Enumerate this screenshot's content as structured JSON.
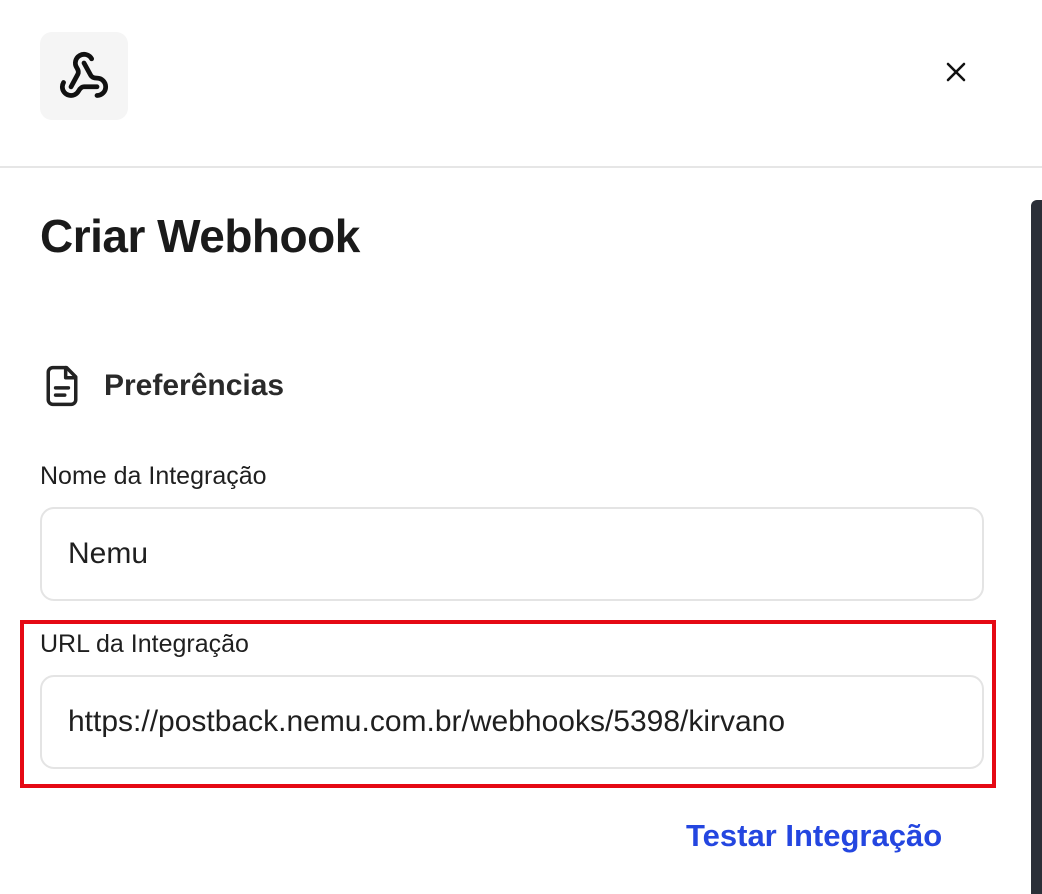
{
  "header": {
    "logo_icon": "webhook-icon",
    "close_icon": "close-icon"
  },
  "main": {
    "title": "Criar Webhook",
    "section": {
      "icon": "document-icon",
      "title": "Preferências"
    },
    "fields": [
      {
        "label": "Nome da Integração",
        "value": "Nemu"
      },
      {
        "label": "URL da Integração",
        "value": "https://postback.nemu.com.br/webhooks/5398/kirvano"
      }
    ],
    "test_button_label": "Testar Integração"
  },
  "colors": {
    "accent": "#2446e0",
    "highlight": "#e50914",
    "scrollbar": "#2b2f38"
  }
}
